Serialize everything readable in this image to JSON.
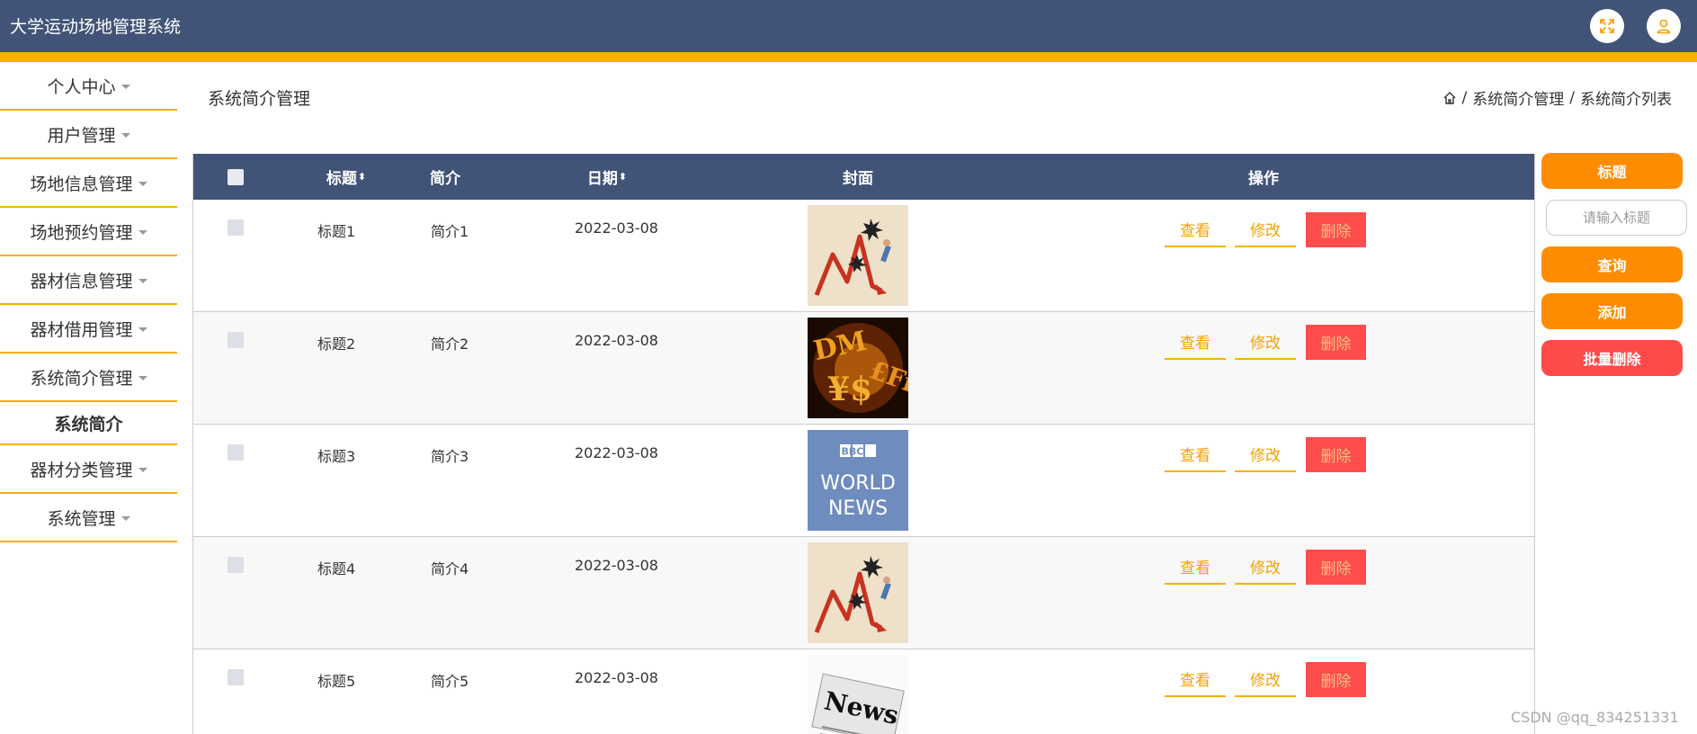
{
  "app": {
    "title": "大学运动场地管理系统"
  },
  "header": {
    "fullscreen_icon": "fullscreen-icon",
    "user_icon": "user-icon"
  },
  "sidebar": {
    "items": [
      {
        "label": "个人中心",
        "has_caret": true
      },
      {
        "label": "用户管理",
        "has_caret": true
      },
      {
        "label": "场地信息管理",
        "has_caret": true
      },
      {
        "label": "场地预约管理",
        "has_caret": true
      },
      {
        "label": "器材信息管理",
        "has_caret": true
      },
      {
        "label": "器材借用管理",
        "has_caret": true
      },
      {
        "label": "系统简介管理",
        "has_caret": true
      },
      {
        "label": "系统简介",
        "has_caret": false,
        "active": true
      },
      {
        "label": "器材分类管理",
        "has_caret": true
      },
      {
        "label": "系统管理",
        "has_caret": true
      }
    ]
  },
  "page": {
    "title": "系统简介管理",
    "breadcrumb": {
      "home_icon": "home-icon",
      "sep": "/",
      "level1": "系统简介管理",
      "level2": "系统简介列表"
    }
  },
  "table": {
    "headers": {
      "title": "标题",
      "intro": "简介",
      "date": "日期",
      "cover": "封面",
      "actions": "操作"
    },
    "rows": [
      {
        "title": "标题1",
        "intro": "简介1",
        "date": "2022-03-08",
        "cover": "falling-chart"
      },
      {
        "title": "标题2",
        "intro": "简介2",
        "date": "2022-03-08",
        "cover": "currency"
      },
      {
        "title": "标题3",
        "intro": "简介3",
        "date": "2022-03-08",
        "cover": "bbc-world-news"
      },
      {
        "title": "标题4",
        "intro": "简介4",
        "date": "2022-03-08",
        "cover": "falling-chart"
      },
      {
        "title": "标题5",
        "intro": "简介5",
        "date": "2022-03-08",
        "cover": "news-paper"
      }
    ],
    "actions": {
      "view": "查看",
      "edit": "修改",
      "delete": "删除"
    },
    "cover_text": {
      "bbc_line1": "BBC",
      "bbc_line2": "WORLD",
      "bbc_line3": "NEWS",
      "news": "News"
    }
  },
  "right_panel": {
    "label": "标题",
    "search_placeholder": "请输入标题",
    "query": "查询",
    "add": "添加",
    "batch_delete": "批量删除"
  },
  "watermark": "CSDN @qq_834251331",
  "colors": {
    "header": "#415477",
    "accent": "#f8b000",
    "orange": "#ff8c00",
    "danger": "#ff4c4c"
  }
}
